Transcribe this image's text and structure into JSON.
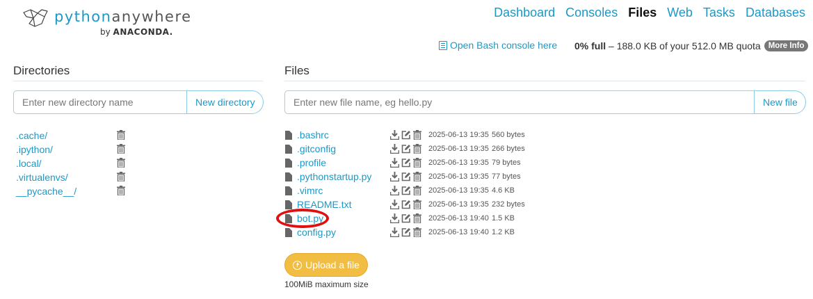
{
  "brand": {
    "word_prefix": "python",
    "word_suffix": "anywhere",
    "by": "by",
    "company": "ANACONDA."
  },
  "nav": {
    "items": [
      {
        "label": "Dashboard"
      },
      {
        "label": "Consoles"
      },
      {
        "label": "Files"
      },
      {
        "label": "Web"
      },
      {
        "label": "Tasks"
      },
      {
        "label": "Databases"
      }
    ],
    "active": "Files"
  },
  "toolbar": {
    "bash_link": "Open Bash console here",
    "quota_pct": "0% full",
    "quota_rest": "– 188.0 KB of your 512.0 MB quota",
    "more_info": "More Info"
  },
  "directories": {
    "title": "Directories",
    "input_placeholder": "Enter new directory name",
    "button": "New directory",
    "items": [
      {
        "name": ".cache/"
      },
      {
        "name": ".ipython/"
      },
      {
        "name": ".local/"
      },
      {
        "name": ".virtualenvs/"
      },
      {
        "name": "__pycache__/"
      }
    ]
  },
  "files": {
    "title": "Files",
    "input_placeholder": "Enter new file name, eg hello.py",
    "button": "New file",
    "items": [
      {
        "name": ".bashrc",
        "date": "2025-06-13 19:35",
        "size": "560 bytes"
      },
      {
        "name": ".gitconfig",
        "date": "2025-06-13 19:35",
        "size": "266 bytes"
      },
      {
        "name": ".profile",
        "date": "2025-06-13 19:35",
        "size": "79 bytes"
      },
      {
        "name": ".pythonstartup.py",
        "date": "2025-06-13 19:35",
        "size": "77 bytes"
      },
      {
        "name": ".vimrc",
        "date": "2025-06-13 19:35",
        "size": "4.6 KB"
      },
      {
        "name": "README.txt",
        "date": "2025-06-13 19:35",
        "size": "232 bytes"
      },
      {
        "name": "bot.py",
        "date": "2025-06-13 19:40",
        "size": "1.5 KB"
      },
      {
        "name": "config.py",
        "date": "2025-06-13 19:40",
        "size": "1.2 KB"
      }
    ],
    "highlighted": "bot.py",
    "upload_button": "Upload a file",
    "upload_note": "100MiB maximum size"
  },
  "icons": {
    "file": "file-icon",
    "trash": "trash-icon",
    "download": "download-icon",
    "edit": "edit-icon",
    "upload": "upload-icon",
    "console": "console-icon"
  },
  "colors": {
    "accent": "#1d98c6",
    "upload": "#f2bd43",
    "highlight": "#e01010"
  }
}
